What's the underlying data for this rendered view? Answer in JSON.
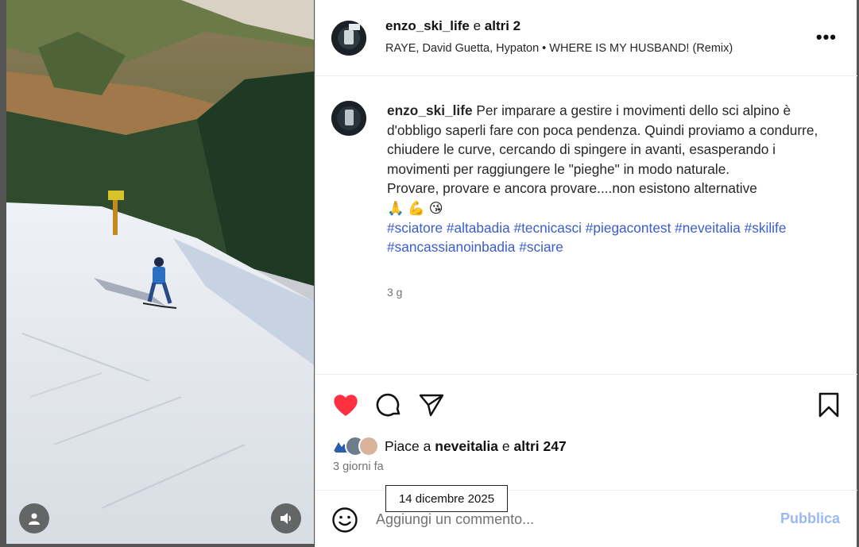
{
  "header": {
    "username": "enzo_ski_life",
    "conjunction": "e",
    "others": "altri 2",
    "music": "RAYE, David Guetta, Hypaton • WHERE IS MY HUSBAND! (Remix)",
    "more_label": "•••"
  },
  "caption": {
    "username": "enzo_ski_life",
    "text": "Per imparare a gestire i movimenti dello sci alpino è d'obbligo saperli fare con poca pendenza. Quindi proviamo a condurre, chiudere le curve, cercando di spingere in avanti, esasperando i movimenti per raggiungere le \"pieghe\" in modo naturale.",
    "line2": "Provare, provare e ancora provare....non esistono alternative",
    "emojis": "🙏 💪 😘",
    "hashtags": "#sciatore #altabadia #tecnicasci #piegacontest #neveitalia #skilife #sancassianoinbadia #sciare",
    "time": "3 g"
  },
  "actions": {
    "icons": [
      "heart-icon",
      "comment-icon",
      "share-icon",
      "bookmark-icon"
    ],
    "like_color": "#ff3040",
    "liked_by_prefix": "Piace a",
    "liked_by_user": "neveitalia",
    "liked_by_conj": "e",
    "liked_by_others": "altri 247",
    "post_age": "3 giorni fa",
    "tooltip_date": "14 dicembre 2025"
  },
  "comment": {
    "placeholder": "Aggiungi un commento...",
    "value": "",
    "publish_label": "Pubblica"
  },
  "media": {
    "icons": [
      "user-tag-icon",
      "volume-icon"
    ]
  }
}
